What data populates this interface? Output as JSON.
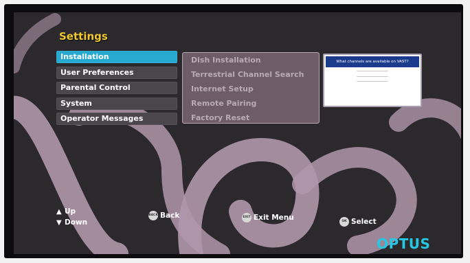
{
  "title": "Settings",
  "menu": {
    "items": [
      {
        "label": "Installation",
        "selected": true
      },
      {
        "label": "User Preferences"
      },
      {
        "label": "Parental Control"
      },
      {
        "label": "System"
      },
      {
        "label": "Operator Messages"
      }
    ]
  },
  "submenu": {
    "items": [
      {
        "label": "Dish Installation"
      },
      {
        "label": "Terrestrial Channel Search"
      },
      {
        "label": "Internet Setup"
      },
      {
        "label": "Remote Pairing"
      },
      {
        "label": "Factory Reset"
      }
    ]
  },
  "info_panel": {
    "heading": "What channels are available on VAST?"
  },
  "hints": {
    "up": "Up",
    "down": "Down",
    "back_icon": "BACK",
    "back": "Back",
    "exit_icon": "EXIT",
    "exit": "Exit Menu",
    "select_icon": "OK",
    "select": "Select"
  },
  "logo": "OPTUS",
  "colors": {
    "accent_title": "#f0c832",
    "selected_item": "#28a9cf",
    "logo": "#25c7e3",
    "info_header": "#1c3b8d"
  }
}
